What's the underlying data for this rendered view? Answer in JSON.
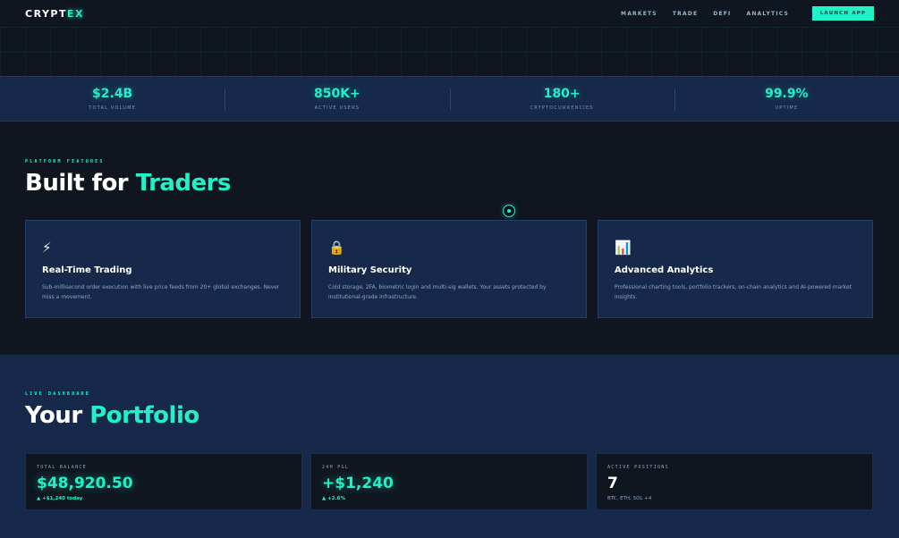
{
  "nav": {
    "logo_main": "CRYPT",
    "logo_accent": "EX",
    "links": [
      "MARKETS",
      "TRADE",
      "DEFI",
      "ANALYTICS"
    ],
    "launch_label": "LAUNCH APP"
  },
  "stats": [
    {
      "value": "$2.4B",
      "label": "TOTAL VOLUME"
    },
    {
      "value": "850K+",
      "label": "ACTIVE USERS"
    },
    {
      "value": "180+",
      "label": "CRYPTOCURRENCIES"
    },
    {
      "value": "99.9%",
      "label": "UPTIME"
    }
  ],
  "features": {
    "eyebrow": "PLATFORM FEATURES",
    "title_main": "Built for ",
    "title_accent": "Traders",
    "cards": [
      {
        "icon": "lightning-icon",
        "glyph": "⚡",
        "title": "Real-Time Trading",
        "desc": "Sub-millisecond order execution with live price feeds from 20+ global exchanges. Never miss a movement."
      },
      {
        "icon": "lock-icon",
        "glyph": "🔒",
        "title": "Military Security",
        "desc": "Cold storage, 2FA, biometric login and multi-sig wallets. Your assets protected by institutional-grade infrastructure."
      },
      {
        "icon": "chart-icon",
        "glyph": "📊",
        "title": "Advanced Analytics",
        "desc": "Professional charting tools, portfolio trackers, on-chain analytics and AI-powered market insights."
      }
    ]
  },
  "portfolio": {
    "eyebrow": "LIVE DASHBOARD",
    "title_main": "Your ",
    "title_accent": "Portfolio",
    "cards": [
      {
        "label": "TOTAL BALANCE",
        "value": "$48,920.50",
        "sub": "▲ +$1,240 today"
      },
      {
        "label": "24H P&L",
        "value": "+$1,240",
        "sub": "▲ +2.6%"
      },
      {
        "label": "ACTIVE POSITIONS",
        "value": "7",
        "sub": "BTC, ETH, SOL +4"
      }
    ]
  },
  "colors": {
    "accent": "#1ff2c8",
    "background": "#0f161f",
    "panel": "#17294a"
  }
}
